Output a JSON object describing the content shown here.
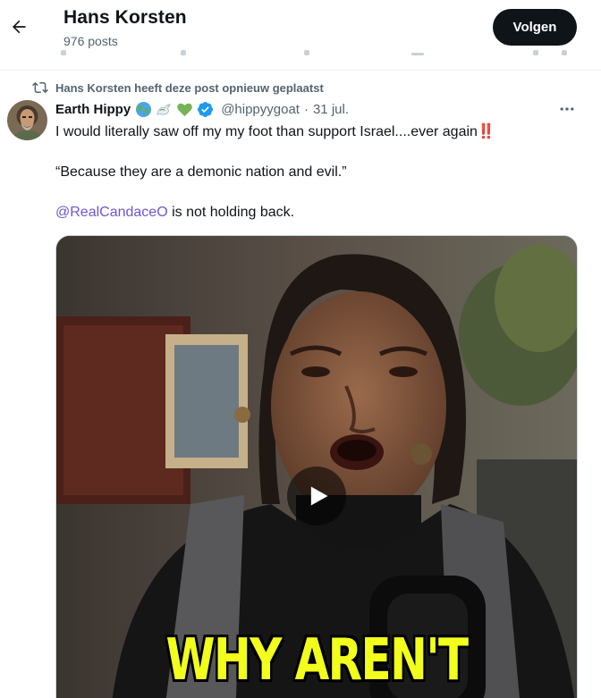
{
  "header": {
    "title": "Hans Korsten",
    "post_count": "976 posts",
    "follow_label": "Volgen"
  },
  "post": {
    "repost_notice": "Hans Korsten heeft deze post opnieuw geplaatst",
    "author": {
      "display_name": "Earth Hippy",
      "name_emojis": [
        "globe-icon",
        "dove-icon",
        "green-heart-icon"
      ],
      "verified": true,
      "handle": "@hippyygoat",
      "date": "31 jul."
    },
    "text": {
      "line1": "I would literally saw off my my foot than support Israel....ever again",
      "line1_emoji": "‼️",
      "line2": "“Because they are a demonic nation and evil.”",
      "mention": "@RealCandaceO",
      "line3_rest": " is not holding back."
    },
    "media": {
      "type": "video",
      "caption_overlay": "WHY AREN'T"
    }
  },
  "colors": {
    "accent_link": "#6e56cf",
    "verified_blue": "#1d9bf0",
    "follow_button_bg": "#0f1419",
    "secondary_text": "#536471",
    "caption_yellow": "#f2ff1c"
  }
}
